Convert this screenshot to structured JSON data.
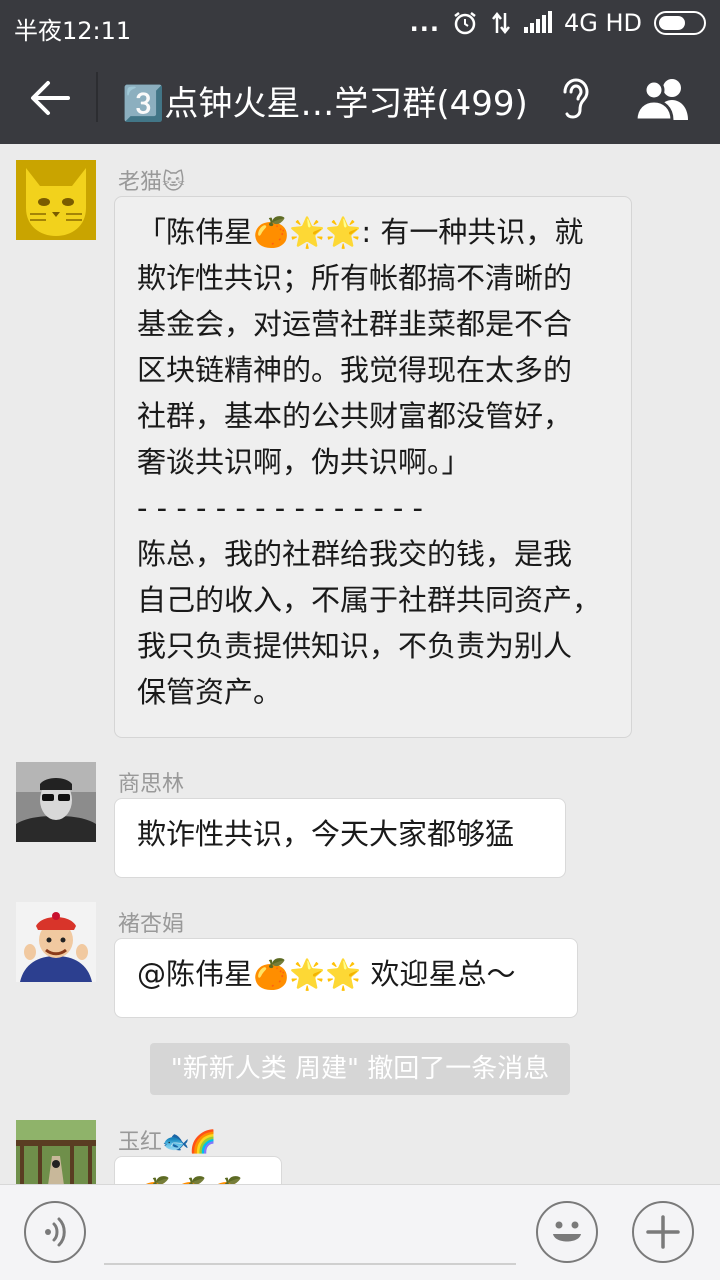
{
  "status_bar": {
    "time": "半夜12:11",
    "dots": "...",
    "network": "4G HD",
    "icons": [
      "alarm-icon",
      "data-arrows-icon",
      "signal-icon",
      "battery-icon"
    ]
  },
  "header": {
    "title": "3️⃣点钟火星…学习群(499)",
    "icons": [
      "back-arrow-icon",
      "earpiece-icon",
      "group-members-icon"
    ]
  },
  "messages": [
    {
      "sender": "老猫🐱",
      "avatar": "cat-avatar",
      "quote_lines": [
        "「陈伟星🍊🌟🌟: 有一种共识，就",
        "欺诈性共识；所有帐都搞不清晰的",
        "基金会，对运营社群韭菜都是不合",
        "区块链精神的。我觉得现在太多的",
        "社群，基本的公共财富都没管好，",
        "奢谈共识啊，伪共识啊。」",
        "- - - - - - - - - - - - - - -",
        "陈总，我的社群给我交的钱，是我",
        "自己的收入，不属于社群共同资产，",
        "我只负责提供知识，不负责为别人",
        "保管资产。"
      ]
    },
    {
      "sender": "商思林",
      "avatar": "man-with-sunglasses-avatar",
      "text": "欺诈性共识，今天大家都够猛"
    },
    {
      "sender": "褚杏娟",
      "avatar": "cartoon-character-avatar",
      "text": "@陈伟星🍊🌟🌟  欢迎星总～"
    },
    {
      "sender": "玉红🐟🌈",
      "avatar": "garden-path-avatar",
      "text": "🍊🍊🍊"
    }
  ],
  "system_notice": "\"新新人类  周建\" 撤回了一条消息",
  "input_bar": {
    "icons": [
      "voice-icon",
      "emoji-icon",
      "plus-icon"
    ]
  },
  "colors": {
    "bar": "#393a3f",
    "background": "#ebebeb",
    "bubble": "#ffffff",
    "quote_bubble": "#efefef",
    "system_pill": "#d6d6d6"
  }
}
